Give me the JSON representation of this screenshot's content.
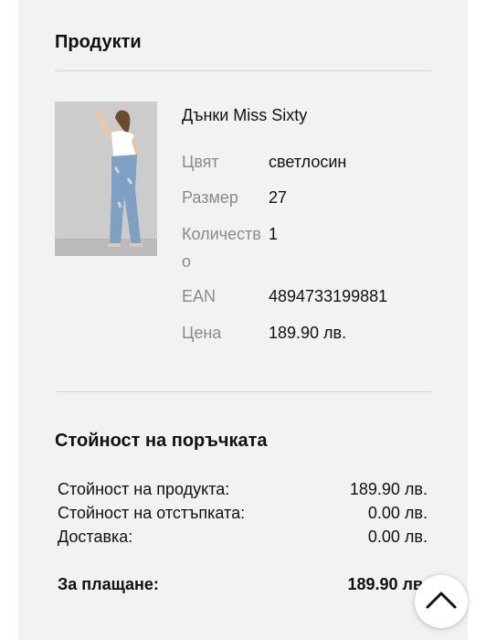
{
  "products": {
    "title": "Продукти",
    "item": {
      "name": "Дънки Miss Sixty",
      "attributes": [
        {
          "label": "Цвят",
          "value": "светлосин"
        },
        {
          "label": "Размер",
          "value": "27"
        },
        {
          "label_line1": "Количеств",
          "label_line2": "о",
          "value": "1"
        },
        {
          "label": "EAN",
          "value": "4894733199881"
        },
        {
          "label": "Цена",
          "value": "189.90 лв."
        }
      ]
    }
  },
  "order": {
    "title": "Стойност на поръчката",
    "rows": [
      {
        "label": "Стойност на продукта:",
        "value": "189.90 лв."
      },
      {
        "label": "Стойност на отстъпката:",
        "value": "0.00 лв."
      },
      {
        "label": "Доставка:",
        "value": "0.00 лв."
      }
    ],
    "total": {
      "label": "За плащане:",
      "value": "189.90 лв."
    }
  },
  "icons": {
    "scroll_top": "chevron-up-icon"
  }
}
